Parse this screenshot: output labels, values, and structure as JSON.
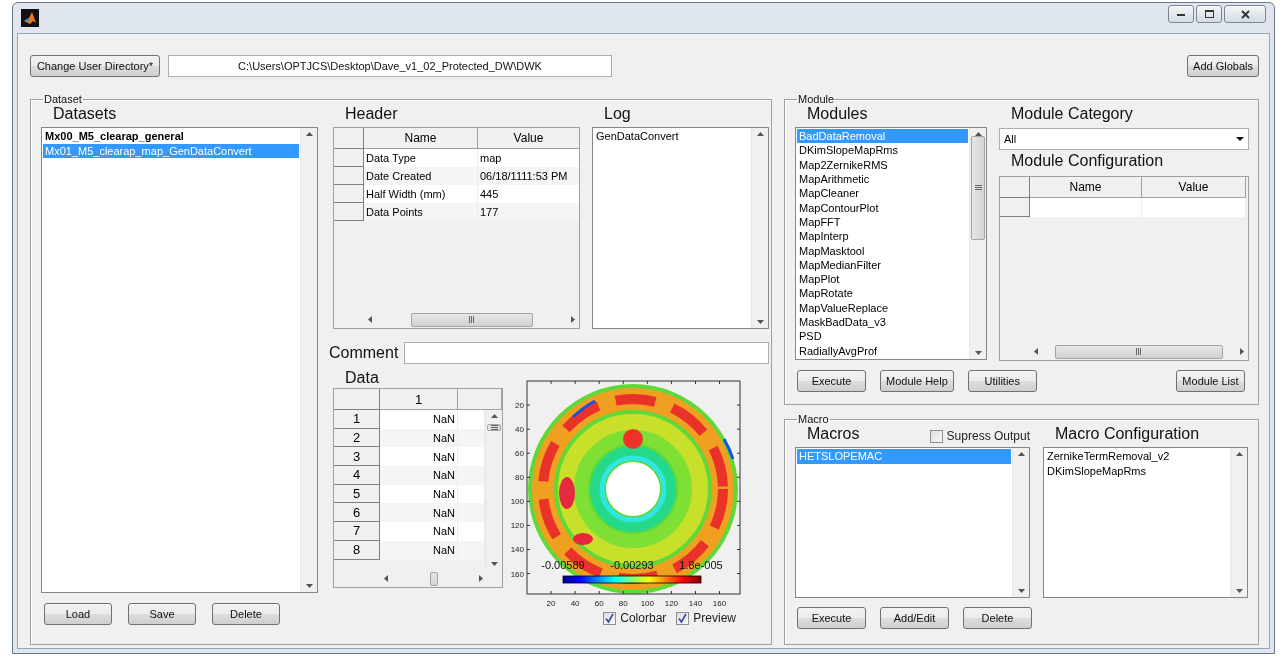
{
  "toolbar": {
    "change_dir_button": "Change User Directory*",
    "path": "C:\\Users\\OPTJCS\\Desktop\\Dave_v1_02_Protected_DW\\DWK",
    "add_globals_button": "Add Globals"
  },
  "dataset": {
    "legend": "Dataset",
    "datasets_title": "Datasets",
    "datasets": [
      {
        "label": "Mx00_M5_clearap_general",
        "bold": true,
        "selected": false
      },
      {
        "label": "Mx01_M5_clearap_map_GenDataConvert",
        "bold": false,
        "selected": true
      }
    ],
    "header": {
      "title": "Header",
      "columns": [
        "Name",
        "Value"
      ],
      "rows": [
        [
          "Data Type",
          "map"
        ],
        [
          "Date Created",
          "06/18/1111:53 PM"
        ],
        [
          "Half Width (mm)",
          "445"
        ],
        [
          "Data Points",
          "177"
        ]
      ]
    },
    "log": {
      "title": "Log",
      "items": [
        {
          "label": "GenDataConvert",
          "selected": false
        }
      ]
    },
    "comment": {
      "label": "Comment"
    },
    "data": {
      "title": "Data",
      "column": "1",
      "rows": [
        {
          "index": "1",
          "value": "NaN"
        },
        {
          "index": "2",
          "value": "NaN"
        },
        {
          "index": "3",
          "value": "NaN"
        },
        {
          "index": "4",
          "value": "NaN"
        },
        {
          "index": "5",
          "value": "NaN"
        },
        {
          "index": "6",
          "value": "NaN"
        },
        {
          "index": "7",
          "value": "NaN"
        },
        {
          "index": "8",
          "value": "NaN"
        }
      ]
    },
    "plot": {
      "x_ticks": [
        "20",
        "40",
        "60",
        "80",
        "100",
        "120",
        "140",
        "160"
      ],
      "y_ticks": [
        "20",
        "40",
        "60",
        "80",
        "100",
        "120",
        "140",
        "160"
      ],
      "colorbar_labels": [
        "-0.00589",
        "-0.00293",
        "1.8e-005"
      ]
    },
    "options": [
      {
        "label": "Colorbar",
        "checked": true
      },
      {
        "label": "Preview",
        "checked": true
      }
    ],
    "buttons": [
      "Load",
      "Save",
      "Delete"
    ]
  },
  "module": {
    "legend": "Module",
    "modules_title": "Modules",
    "modules": [
      {
        "label": "BadDataRemoval",
        "selected": true
      },
      {
        "label": "DKimSlopeMapRms",
        "selected": false
      },
      {
        "label": "Map2ZernikeRMS",
        "selected": false
      },
      {
        "label": "MapArithmetic",
        "selected": false
      },
      {
        "label": "MapCleaner",
        "selected": false
      },
      {
        "label": "MapContourPlot",
        "selected": false
      },
      {
        "label": "MapFFT",
        "selected": false
      },
      {
        "label": "MapInterp",
        "selected": false
      },
      {
        "label": "MapMasktool",
        "selected": false
      },
      {
        "label": "MapMedianFilter",
        "selected": false
      },
      {
        "label": "MapPlot",
        "selected": false
      },
      {
        "label": "MapRotate",
        "selected": false
      },
      {
        "label": "MapValueReplace",
        "selected": false
      },
      {
        "label": "MaskBadData_v3",
        "selected": false
      },
      {
        "label": "PSD",
        "selected": false
      },
      {
        "label": "RadiallyAvgProf",
        "selected": false
      }
    ],
    "category_title": "Module Category",
    "category_value": "All",
    "config_title": "Module Configuration",
    "config_columns": [
      "Name",
      "Value"
    ],
    "buttons": [
      "Execute",
      "Module Help",
      "Utilities"
    ],
    "list_button": "Module List"
  },
  "macro": {
    "legend": "Macro",
    "macros_title": "Macros",
    "suppress": {
      "label": "Supress Output",
      "checked": false
    },
    "macros": [
      {
        "label": "HETSLOPEMAC",
        "selected": true
      }
    ],
    "config_title": "Macro Configuration",
    "config_items": [
      {
        "label": "ZernikeTermRemoval_v2",
        "selected": false
      },
      {
        "label": "DKimSlopeMapRms",
        "selected": false
      }
    ],
    "buttons": [
      "Execute",
      "Add/Edit",
      "Delete"
    ]
  }
}
